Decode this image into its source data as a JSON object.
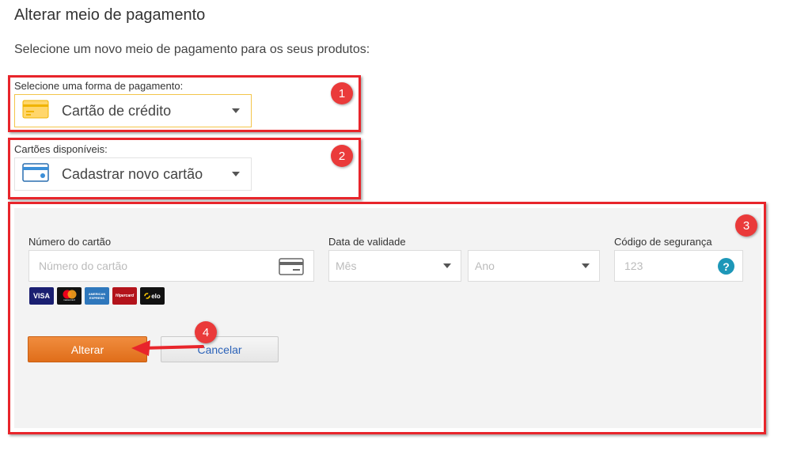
{
  "header": {
    "title": "Alterar meio de pagamento",
    "subtitle": "Selecione um novo meio de pagamento para os seus produtos:"
  },
  "payment_method": {
    "label": "Selecione uma forma de pagamento:",
    "selected": "Cartão de crédito",
    "icon": "credit-card-icon"
  },
  "available_cards": {
    "label": "Cartões disponíveis:",
    "selected": "Cadastrar novo cartão",
    "icon": "card-icon"
  },
  "card_form": {
    "number_label": "Número do cartão",
    "number_placeholder": "Número do cartão",
    "expiry_label": "Data de validade",
    "month_placeholder": "Mês",
    "year_placeholder": "Ano",
    "cvv_label": "Código de segurança",
    "cvv_placeholder": "123",
    "help_glyph": "?",
    "brands": [
      "VISA",
      "mastercard",
      "american express",
      "Hipercard",
      "elo"
    ]
  },
  "actions": {
    "submit_label": "Alterar",
    "cancel_label": "Cancelar"
  },
  "annotations": {
    "badge1": "1",
    "badge2": "2",
    "badge3": "3",
    "badge4": "4"
  },
  "colors": {
    "annotation_red": "#e8252b",
    "accent_orange": "#e67a28",
    "selected_border": "#f3c54a",
    "help_teal": "#1d97b8",
    "link_blue": "#2b62b8"
  }
}
